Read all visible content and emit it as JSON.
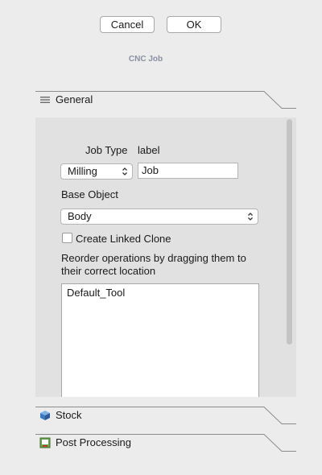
{
  "buttons": {
    "cancel": "Cancel",
    "ok": "OK"
  },
  "task": {
    "title": "CNC Job"
  },
  "sections": {
    "general": {
      "label": "General",
      "icon": "list-lines-icon"
    },
    "stock": {
      "label": "Stock",
      "icon": "blue-cube-icon"
    },
    "post": {
      "label": "Post Processing",
      "icon": "post-processor-icon"
    }
  },
  "general": {
    "job_type_label": "Job Type",
    "job_type_value_label": "label",
    "job_type_selected": "Milling",
    "job_label_value": "Job",
    "base_object_label": "Base Object",
    "base_object_selected": "Body",
    "linked_clone_label": "Create Linked Clone",
    "linked_clone_checked": false,
    "reorder_text": "Reorder operations by dragging them to their correct location",
    "operations": [
      "Default_Tool"
    ]
  },
  "colors": {
    "panel_bg": "#e1e1e1",
    "window_bg": "#ececec",
    "title": "#8a90a3"
  }
}
